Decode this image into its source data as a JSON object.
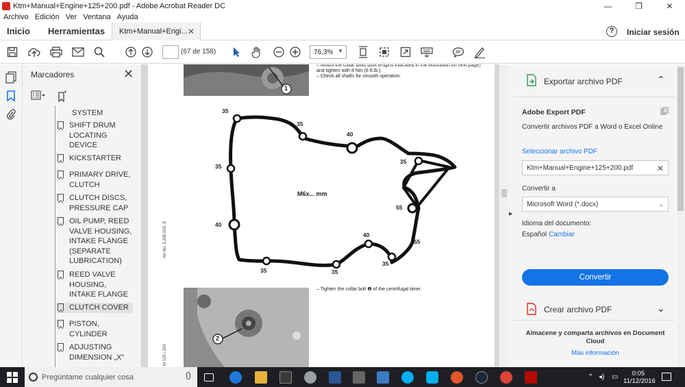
{
  "window": {
    "title": "Ktm+Manual+Engine+125+200.pdf - Adobe Acrobat Reader DC",
    "minimize": "—",
    "maximize": "❐",
    "close": "✕"
  },
  "menu": [
    "Archivo",
    "Edición",
    "Ver",
    "Ventana",
    "Ayuda"
  ],
  "tabs": {
    "home": "Inicio",
    "tools": "Herramientas",
    "document": "Ktm+Manual+Engi...",
    "close": "✕"
  },
  "header": {
    "help": "?",
    "signin": "Iniciar sesión"
  },
  "toolbar": {
    "page_current": "",
    "page_count": "(67 de 158)",
    "zoom": "76,3%"
  },
  "bookmarks": {
    "title": "Marcadores",
    "items": [
      {
        "label": "SYSTEM"
      },
      {
        "label": "SHIFT DRUM LOCATING DEVICE"
      },
      {
        "label": "KICKSTARTER"
      },
      {
        "label": "PRIMARY DRIVE, CLUTCH"
      },
      {
        "label": "CLUTCH DISCS, PRESSURE CAP"
      },
      {
        "label": "OIL PUMP, REED VALVE HOUSING, INTAKE FLANGE (SEPARATE LUBRICATION)"
      },
      {
        "label": "REED VALVE HOUSING, INTAKE FLANGE"
      },
      {
        "label": "CLUTCH COVER"
      },
      {
        "label": "PISTON, CYLINDER"
      },
      {
        "label": "ADJUSTING DIMENSION „X“"
      }
    ]
  },
  "document": {
    "top_text": "–  Mount the collar bolts (bolt lengths indicated in the illustration on next page) and tighten with 8 Nm (6 ft.lb.).",
    "top_text2": "–  Check all shafts for smooth operation.",
    "diagram_center": "M6x... mm",
    "diagram_labels": [
      "35",
      "35",
      "40",
      "35",
      "35",
      "55",
      "55",
      "40",
      "35",
      "35",
      "40",
      "35"
    ],
    "art_no": "Art.No. 3.206.005 -E",
    "bottom_text": "–  Tighten the collar bolt ❷ of the centrifugal timer.",
    "side_code": "M  125 / 200",
    "callout1": "1",
    "callout2": "2"
  },
  "export_panel": {
    "header": "Exportar archivo PDF",
    "service": "Adobe Export PDF",
    "description": "Convertir archivos PDF a Word o Excel Online",
    "select_file": "Seleccionar archivo PDF",
    "file_name": "Ktm+Manual+Engine+125+200.pdf",
    "convert_to": "Convertir a",
    "format": "Microsoft Word (*.docx)",
    "doc_language": "Idioma del documento:",
    "language": "Español",
    "change": "Cambiar",
    "convert_button": "Convertir",
    "create_pdf": "Crear archivo PDF",
    "store": "Almacene y comparta archivos en Document Cloud",
    "more_info": "Más información",
    "accent": "#1473e6"
  },
  "taskbar": {
    "search_placeholder": "Pregúntame cualquier cosa",
    "time": "0:05",
    "date": "11/12/2016"
  }
}
